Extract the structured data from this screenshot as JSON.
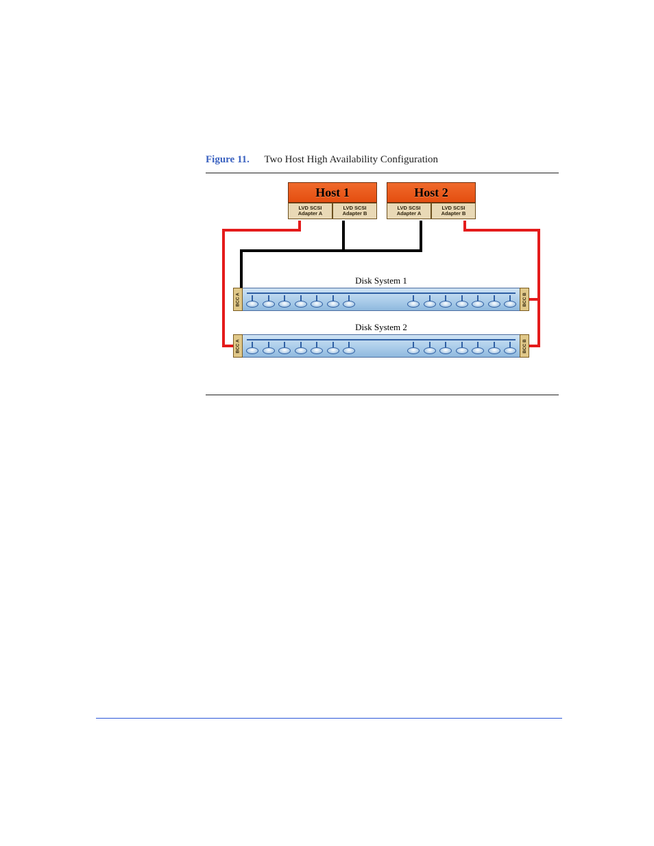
{
  "figure": {
    "label": "Figure 11.",
    "title": "Two Host High Availability Configuration"
  },
  "hosts": [
    {
      "name": "Host 1",
      "adapters": [
        "LVD SCSI\nAdapter A",
        "LVD SCSI\nAdapter B"
      ]
    },
    {
      "name": "Host 2",
      "adapters": [
        "LVD SCSI\nAdapter A",
        "LVD SCSI\nAdapter B"
      ]
    }
  ],
  "disk_systems": [
    {
      "label": "Disk System 1",
      "bcc_left": "BCC A",
      "bcc_right": "BCC B",
      "disks_per_group": 7
    },
    {
      "label": "Disk System 2",
      "bcc_left": "BCC A",
      "bcc_right": "BCC B",
      "disks_per_group": 7
    }
  ],
  "colors": {
    "path_a": "#e41b1b",
    "path_b": "#000000",
    "host_bg": "#ef5a1c",
    "adapter_bg": "#e9d9b6",
    "disk_bay": "#a9cbe9",
    "accent_blue": "#3b62c0"
  }
}
